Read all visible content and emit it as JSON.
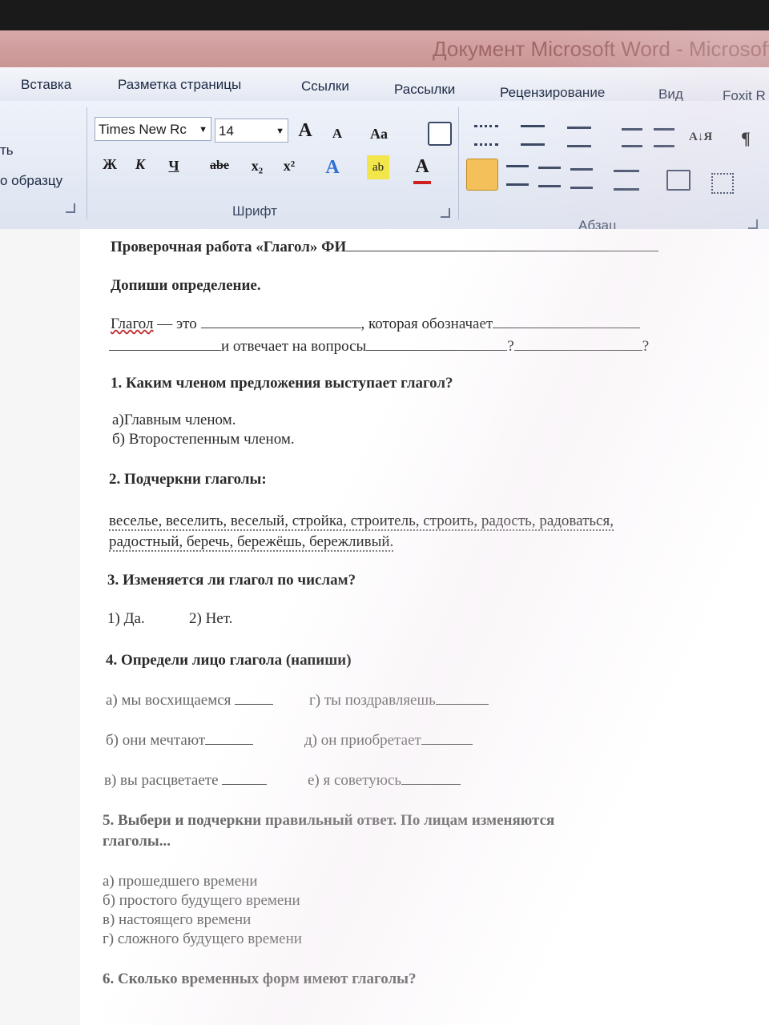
{
  "window": {
    "title": "Документ Microsoft Word - Microsoft"
  },
  "tabs": [
    {
      "label": "Вставка"
    },
    {
      "label": "Разметка страницы"
    },
    {
      "label": "Ссылки"
    },
    {
      "label": "Рассылки"
    },
    {
      "label": "Рецензирование"
    },
    {
      "label": "Вид"
    },
    {
      "label": "Foxit R"
    }
  ],
  "ribbon": {
    "clipboard": {
      "paste_fragment": "ть",
      "format_painter": "о образцу"
    },
    "font": {
      "name": "Times New Rc",
      "size": "14",
      "group_label": "Шрифт",
      "grow": "A",
      "shrink": "A",
      "case": "Aa",
      "bold": "Ж",
      "italic": "К",
      "underline": "Ч",
      "strike": "abe",
      "subscript": "x₂",
      "superscript": "x²",
      "effects": "A",
      "highlight": "ab",
      "color": "A"
    },
    "paragraph": {
      "group_label": "Абзац",
      "sort": "А↓Я",
      "pilcrow": "¶"
    }
  },
  "document": {
    "title": "Проверочная работа «Глагол» ФИ",
    "task_intro": "Допиши определение.",
    "def_word": "Глагол",
    "def_dash": " — это ",
    "def_which": ", которая обозначает",
    "def_answers": "и отвечает на вопросы",
    "q_mark": "?",
    "q1": "1. Каким членом предложения выступает глагол?",
    "q1_a": "а)Главным членом.",
    "q1_b": "б) Второстепенным членом.",
    "q2": "2. Подчеркни глаголы:",
    "q2_line1": "веселье, веселить, веселый, стройка, строитель, строить, радость, радоваться,",
    "q2_line2": "радостный, беречь, бережёшь, бережливый.",
    "q3": "3. Изменяется ли глагол по числам?",
    "q3_a": "1) Да.",
    "q3_b": "2) Нет.",
    "q4": "4. Определи лицо глагола (напиши)",
    "q4_a": "а) мы восхищаемся",
    "q4_g": "г) ты поздравляешь",
    "q4_b": "б) они мечтают",
    "q4_d": "д) он приобретает",
    "q4_v": "в) вы расцветаете",
    "q4_e": "е) я советуюсь",
    "q5_line1": "5. Выбери и подчеркни правильный ответ. По лицам изменяются",
    "q5_line2": "глаголы...",
    "q5_a": "а) прошедшего времени",
    "q5_b": "б) простого будущего времени",
    "q5_v": "в) настоящего времени",
    "q5_g": "г) сложного будущего времени",
    "q6": "6. Сколько временных форм имеют глаголы?"
  }
}
